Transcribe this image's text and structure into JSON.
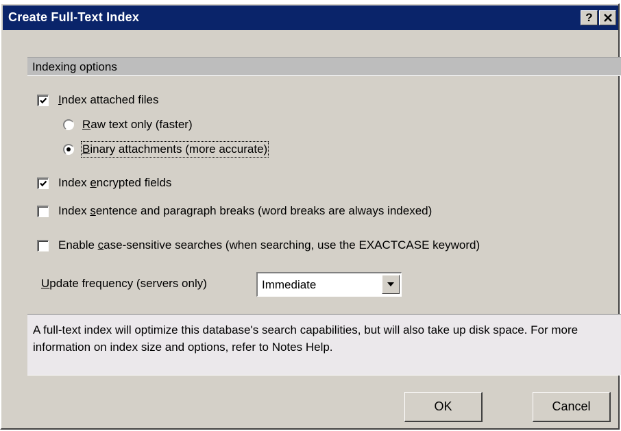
{
  "window": {
    "title": "Create Full-Text Index",
    "help_label": "?"
  },
  "section": {
    "title": "Indexing options"
  },
  "options": {
    "index_attached_files": {
      "pre": "",
      "key": "I",
      "post": "ndex attached files",
      "checked": true
    },
    "raw_text_only": {
      "pre": "",
      "key": "R",
      "post": "aw text only (faster)",
      "selected": false
    },
    "binary_attachments": {
      "pre": "",
      "key": "B",
      "post": "inary attachments (more accurate)",
      "selected": true
    },
    "index_encrypted_fields": {
      "pre": "Index ",
      "key": "e",
      "post": "ncrypted fields",
      "checked": true
    },
    "index_sentence_breaks": {
      "pre": "Index ",
      "key": "s",
      "post": "entence and paragraph breaks (word breaks are always indexed)",
      "checked": false
    },
    "case_sensitive": {
      "pre": "Enable ",
      "key": "c",
      "post": "ase-sensitive searches (when searching, use the EXACTCASE keyword)",
      "checked": false
    }
  },
  "update_frequency": {
    "label_key": "U",
    "label_rest": "pdate frequency (servers only)",
    "value": "Immediate"
  },
  "info": {
    "text": "A full-text index will optimize this database's search capabilities, but will also take up disk space. For more information on index size and options, refer to Notes Help."
  },
  "buttons": {
    "ok": "OK",
    "cancel": "Cancel"
  }
}
